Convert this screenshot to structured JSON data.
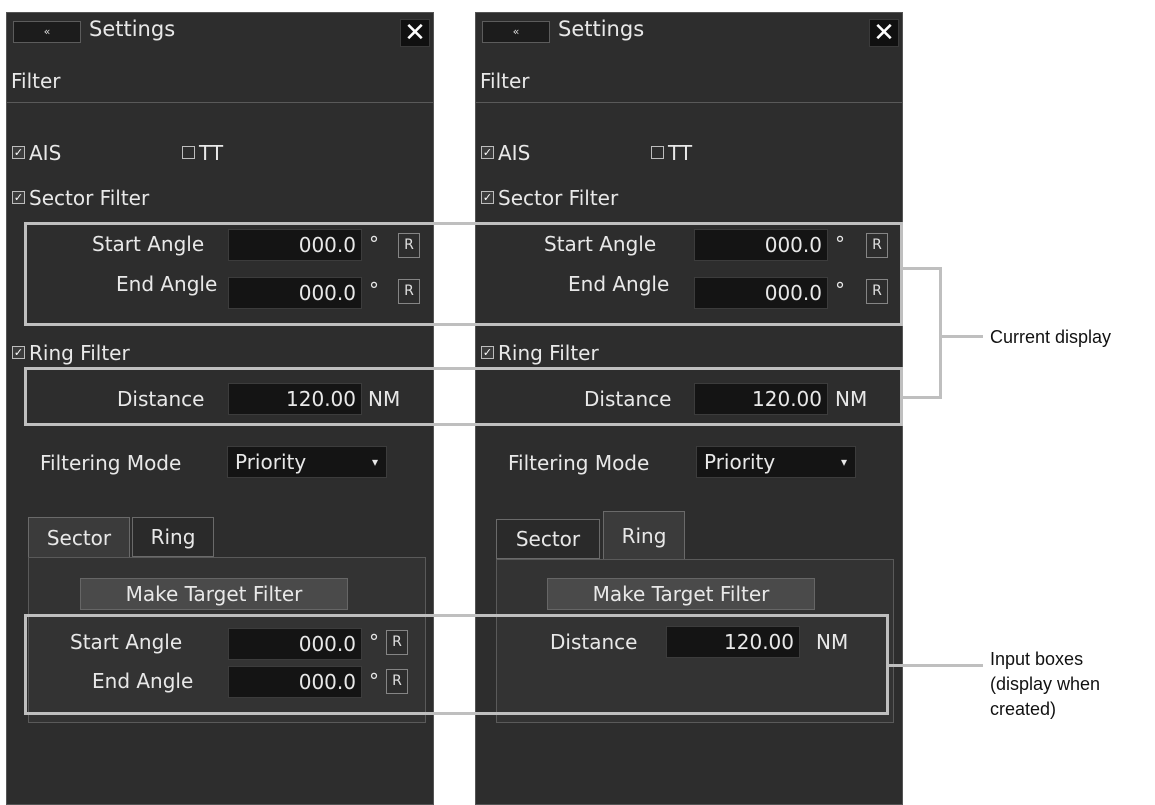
{
  "left": {
    "title": "Settings",
    "collapse_icon": "«",
    "close_icon": "✕",
    "section": "Filter",
    "ais": {
      "label": "AIS",
      "checked": true
    },
    "tt": {
      "label": "TT",
      "checked": false
    },
    "sector_filter": {
      "label": "Sector Filter",
      "checked": true
    },
    "start_angle": {
      "label": "Start Angle",
      "value": "000.0",
      "unit": "°",
      "reset": "R"
    },
    "end_angle": {
      "label": "End Angle",
      "value": "000.0",
      "unit": "°",
      "reset": "R"
    },
    "ring_filter": {
      "label": "Ring Filter",
      "checked": true
    },
    "distance": {
      "label": "Distance",
      "value": "120.00",
      "unit": "NM"
    },
    "filtering_mode": {
      "label": "Filtering Mode",
      "value": "Priority"
    },
    "tabs": [
      {
        "label": "Sector",
        "active": true
      },
      {
        "label": "Ring",
        "active": false
      }
    ],
    "make_target_filter": "Make Target Filter",
    "tab_start_angle": {
      "label": "Start Angle",
      "value": "000.0",
      "unit": "°",
      "reset": "R"
    },
    "tab_end_angle": {
      "label": "End Angle",
      "value": "000.0",
      "unit": "°",
      "reset": "R"
    }
  },
  "right": {
    "title": "Settings",
    "collapse_icon": "«",
    "close_icon": "✕",
    "section": "Filter",
    "ais": {
      "label": "AIS",
      "checked": true
    },
    "tt": {
      "label": "TT",
      "checked": false
    },
    "sector_filter": {
      "label": "Sector Filter",
      "checked": true
    },
    "start_angle": {
      "label": "Start Angle",
      "value": "000.0",
      "unit": "°",
      "reset": "R"
    },
    "end_angle": {
      "label": "End Angle",
      "value": "000.0",
      "unit": "°",
      "reset": "R"
    },
    "ring_filter": {
      "label": "Ring Filter",
      "checked": true
    },
    "distance": {
      "label": "Distance",
      "value": "120.00",
      "unit": "NM"
    },
    "filtering_mode": {
      "label": "Filtering Mode",
      "value": "Priority"
    },
    "tabs": [
      {
        "label": "Sector",
        "active": false
      },
      {
        "label": "Ring",
        "active": true
      }
    ],
    "make_target_filter": "Make Target Filter",
    "tab_distance": {
      "label": "Distance",
      "value": "120.00",
      "unit": "NM"
    }
  },
  "annotations": {
    "current_display": "Current display",
    "input_boxes": "Input boxes (display when created)"
  },
  "colors": {
    "panel_bg": "#2d2d2d",
    "field_bg": "#141414",
    "annotation_line": "#bfbfbf"
  }
}
